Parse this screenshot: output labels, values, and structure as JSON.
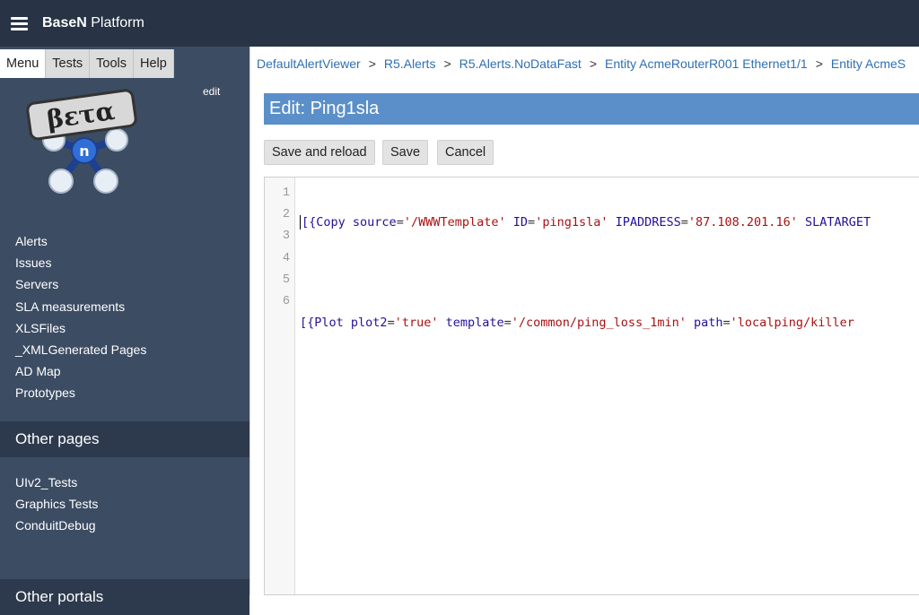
{
  "topbar": {
    "brand_bold": "BaseN",
    "brand_rest": " Platform"
  },
  "sidebar": {
    "tabs": [
      "Menu",
      "Tests",
      "Tools",
      "Help"
    ],
    "edit_label": "edit",
    "logo_text": "βετα",
    "logo_badge": "n",
    "items": [
      "Alerts",
      "Issues",
      "Servers",
      "SLA measurements",
      "XLSFiles",
      "_XMLGenerated Pages",
      "AD Map",
      "Prototypes"
    ],
    "other_pages_header": "Other pages",
    "other_items": [
      "UIv2_Tests",
      "Graphics Tests",
      "ConduitDebug"
    ],
    "portals_header": "Other portals"
  },
  "breadcrumb": [
    "DefaultAlertViewer",
    "R5.Alerts",
    "R5.Alerts.NoDataFast",
    "Entity AcmeRouterR001 Ethernet1/1",
    "Entity AcmeS"
  ],
  "breadcrumb_sep": ">",
  "editor": {
    "title": "Edit: Ping1sla",
    "buttons": {
      "save_reload": "Save and reload",
      "save": "Save",
      "cancel": "Cancel"
    },
    "line_numbers": [
      "1",
      "2",
      "3",
      "4",
      "5",
      "6"
    ],
    "line1": {
      "open": "[{",
      "tag": "Copy",
      "a1": "source",
      "v1": "'/WWWTemplate'",
      "a2": "ID",
      "v2": "'ping1sla'",
      "a3": "IPADDRESS",
      "v3": "'87.108.201.16'",
      "a4": "SLATARGET"
    },
    "line3": {
      "open": "[{",
      "tag": "Plot",
      "a1": "plot2",
      "v1": "'true'",
      "a2": "template",
      "v2": "'/common/ping_loss_1min'",
      "a3": "path",
      "v3": "'localping/killer"
    },
    "eq": "="
  }
}
